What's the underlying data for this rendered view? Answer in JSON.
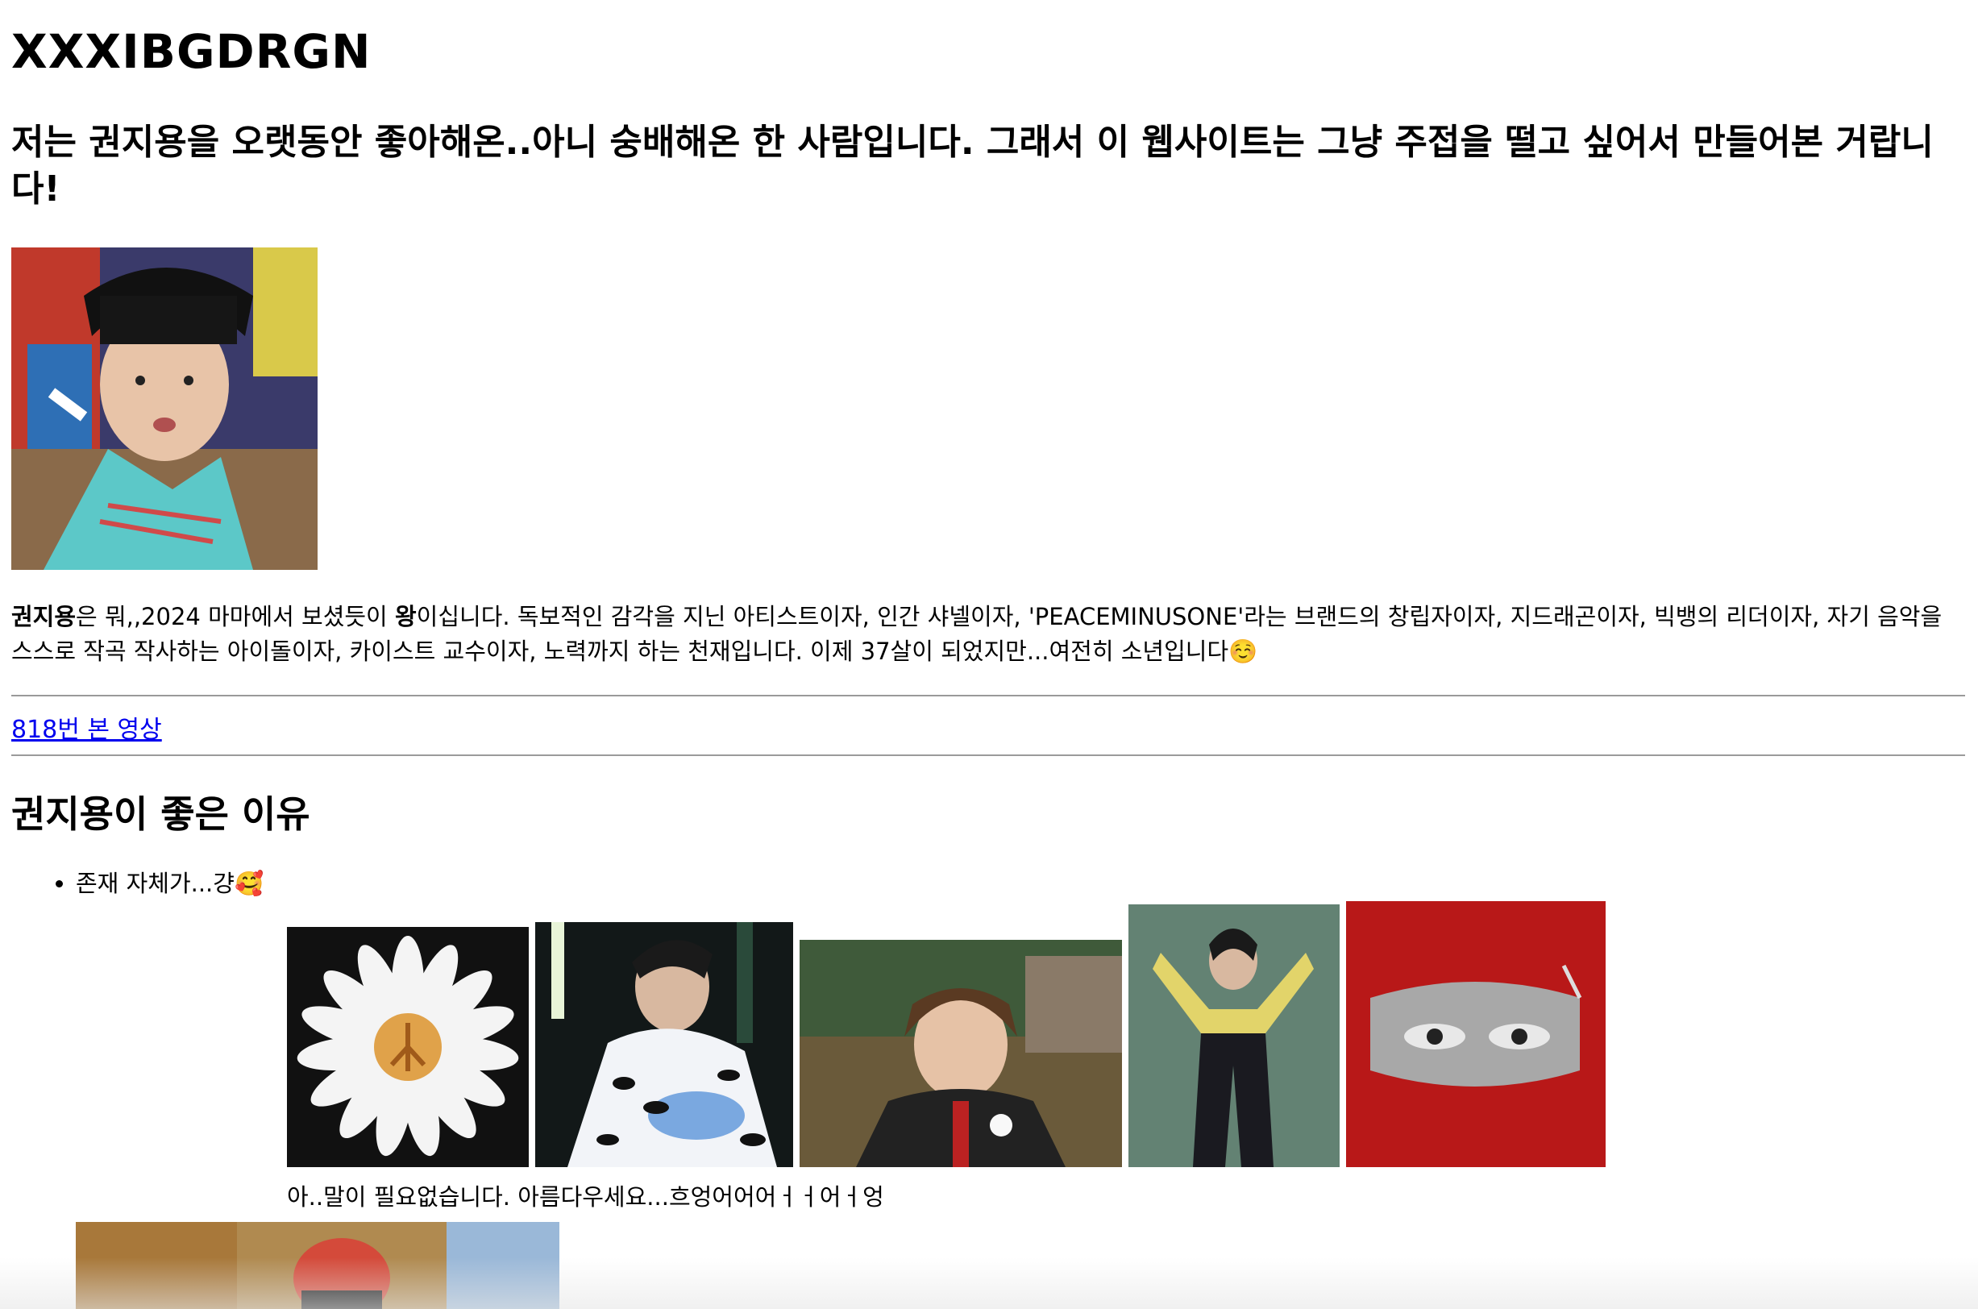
{
  "site": {
    "title": "XXXIBGDRGN"
  },
  "intro": {
    "heading": "저는 권지용을 오랫동안 좋아해온..아니 숭배해온 한 사람입니다. 그래서 이 웹사이트는 그냥 주접을 떨고 싶어서 만들어본 거랍니다!"
  },
  "bio": {
    "name": "권지용",
    "part1": "은 뭐,,2024 마마에서 보셨듯이 ",
    "king": "왕",
    "part2": "이십니다. 독보적인 감각을 지닌 아티스트이자, 인간 샤넬이자, 'PEACEMINUSONE'라는 브랜드의 창립자이자, 지드래곤이자, 빅뱅의 리더이자, 자기 음악을 스스로 작곡 작사하는 아이돌이자, 카이스트 교수이자, 노력까지 하는 천재입니다. 이제 37살이 되었지만...여전히 소년입니다☺️"
  },
  "video_link": {
    "label": "818번 본 영상"
  },
  "reasons": {
    "heading": "권지용이 좋은 이유",
    "items": [
      "존재 자체가...걍🥰"
    ],
    "caption": "아..말이 필요없습니다. 아름다우세요...흐엉어어어ㅓㅓ어ㅓ엉"
  },
  "colors": {
    "link": "#0000ee",
    "rule": "#9a9a9a",
    "balaclava": "#c81e1e"
  }
}
